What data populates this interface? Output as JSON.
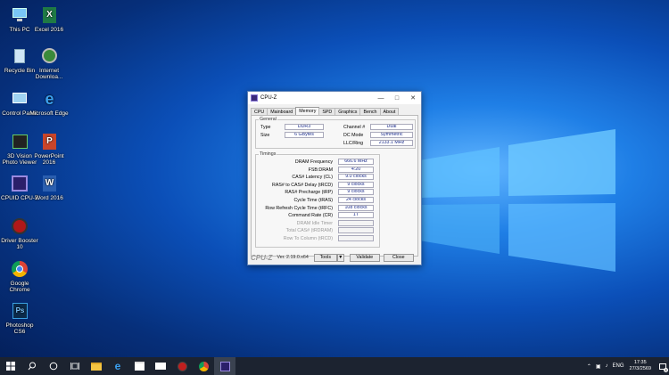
{
  "desktop": {
    "icons": [
      {
        "label": "This PC",
        "icon": "this-pc-icon"
      },
      {
        "label": "Excel 2016",
        "icon": "excel-icon"
      },
      {
        "label": "Recycle Bin",
        "icon": "recycle-bin-icon"
      },
      {
        "label": "Internet Downloa...",
        "icon": "internet-download-icon"
      },
      {
        "label": "Control Panel",
        "icon": "control-panel-icon"
      },
      {
        "label": "Microsoft Edge",
        "icon": "edge-icon"
      },
      {
        "label": "3D Vision Photo Viewer",
        "icon": "3d-vision-icon"
      },
      {
        "label": "PowerPoint 2016",
        "icon": "powerpoint-icon"
      },
      {
        "label": "CPUID CPU-Z",
        "icon": "cpuz-icon"
      },
      {
        "label": "Word 2016",
        "icon": "word-icon"
      },
      {
        "label": "Driver Booster 10",
        "icon": "driver-booster-icon"
      },
      {
        "label": "Google Chrome",
        "icon": "chrome-icon"
      },
      {
        "label": "Photoshop CS6",
        "icon": "photoshop-icon"
      }
    ]
  },
  "window": {
    "title": "CPU-Z",
    "tabs": [
      "CPU",
      "Mainboard",
      "Memory",
      "SPD",
      "Graphics",
      "Bench",
      "About"
    ],
    "active_tab": "Memory",
    "general": {
      "title": "General",
      "type_label": "Type",
      "type_value": "DDR3",
      "size_label": "Size",
      "size_value": "6 GBytes",
      "channel_label": "Channel #",
      "channel_value": "Dual",
      "dc_label": "DC Mode",
      "dc_value": "Symmetric",
      "llc_label": "LLC/Ring",
      "llc_value": "2133.1 MHz"
    },
    "timings": {
      "title": "Timings",
      "rows": [
        {
          "label": "DRAM Frequency",
          "value": "666.6 MHz",
          "disabled": false
        },
        {
          "label": "FSB:DRAM",
          "value": "4:20",
          "disabled": false
        },
        {
          "label": "CAS# Latency (CL)",
          "value": "9.0 clocks",
          "disabled": false
        },
        {
          "label": "RAS# to CAS# Delay (tRCD)",
          "value": "9 clocks",
          "disabled": false
        },
        {
          "label": "RAS# Precharge (tRP)",
          "value": "9 clocks",
          "disabled": false
        },
        {
          "label": "Cycle Time (tRAS)",
          "value": "24 clocks",
          "disabled": false
        },
        {
          "label": "Row Refresh Cycle Time (tRFC)",
          "value": "108 clocks",
          "disabled": false
        },
        {
          "label": "Command Rate (CR)",
          "value": "1T",
          "disabled": false
        },
        {
          "label": "DRAM Idle Timer",
          "value": "",
          "disabled": true
        },
        {
          "label": "Total CAS# (tRDRAM)",
          "value": "",
          "disabled": true
        },
        {
          "label": "Row To Column (tRCD)",
          "value": "",
          "disabled": true
        }
      ]
    },
    "footer": {
      "brand": "CPU-Z",
      "version": "Ver. 2.19.0.x64",
      "tools": "Tools",
      "validate": "Validate",
      "close": "Close"
    }
  },
  "taskbar": {
    "language": "ENG",
    "time": "17:35",
    "date": "27/3/2569",
    "notification_count": "4"
  }
}
